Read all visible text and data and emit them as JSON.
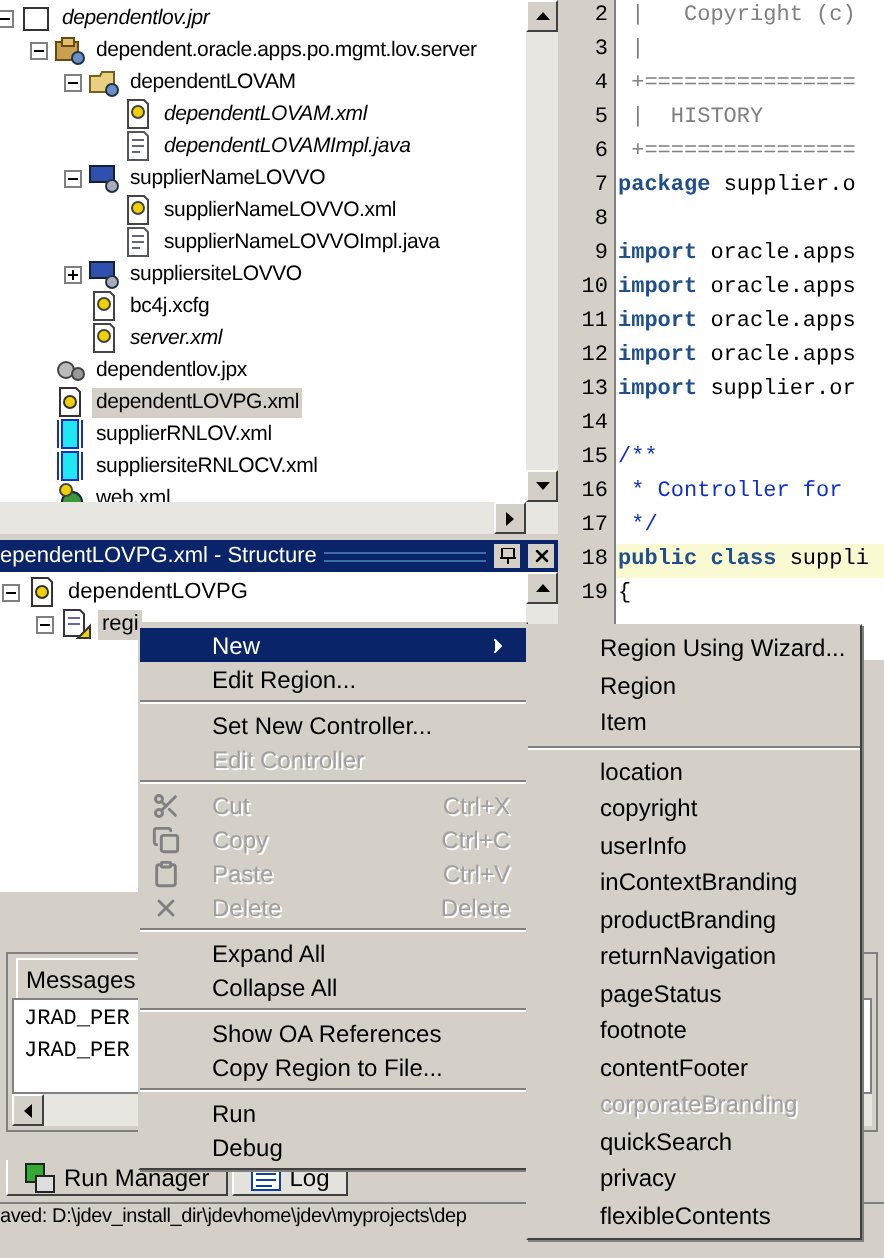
{
  "navigator": {
    "tree": [
      {
        "label": "dependentlov.jpr",
        "kind": "project",
        "italic": true,
        "expanded": true,
        "selected": false,
        "children": [
          {
            "label": "dependent.oracle.apps.po.mgmt.lov.server",
            "kind": "package",
            "expanded": true,
            "selected": false,
            "children": [
              {
                "label": "dependentLOVAM",
                "kind": "module",
                "expanded": true,
                "selected": false,
                "children": [
                  {
                    "label": "dependentLOVAM.xml",
                    "kind": "xml",
                    "italic": true,
                    "selected": false
                  },
                  {
                    "label": "dependentLOVAMImpl.java",
                    "kind": "java",
                    "italic": true,
                    "selected": false
                  }
                ]
              },
              {
                "label": "supplierNameLOVVO",
                "kind": "view",
                "expanded": true,
                "selected": false,
                "children": [
                  {
                    "label": "supplierNameLOVVO.xml",
                    "kind": "xml",
                    "selected": false
                  },
                  {
                    "label": "supplierNameLOVVOImpl.java",
                    "kind": "java",
                    "selected": false
                  }
                ]
              },
              {
                "label": "suppliersiteLOVVO",
                "kind": "view",
                "expanded": false,
                "selected": false
              },
              {
                "label": "bc4j.xcfg",
                "kind": "xml",
                "selected": false
              },
              {
                "label": "server.xml",
                "kind": "xml",
                "italic": true,
                "selected": false
              }
            ]
          },
          {
            "label": "dependentlov.jpx",
            "kind": "gears",
            "selected": false
          },
          {
            "label": "dependentLOVPG.xml",
            "kind": "page",
            "selected": true
          },
          {
            "label": "supplierRNLOV.xml",
            "kind": "region",
            "selected": false
          },
          {
            "label": "suppliersiteRNLOCV.xml",
            "kind": "region",
            "selected": false
          },
          {
            "label": "web.xml",
            "kind": "web",
            "selected": false
          }
        ]
      }
    ]
  },
  "structure": {
    "title": "ependentLOVPG.xml - Structure",
    "tree": [
      {
        "label": "dependentLOVPG",
        "kind": "page",
        "expanded": true,
        "selected": false,
        "children": [
          {
            "label": "regi",
            "kind": "regionedit",
            "expanded": true,
            "selected": true
          }
        ]
      }
    ]
  },
  "editor": {
    "lines": [
      {
        "number": "2",
        "segments": [
          {
            "kind": "comment",
            "text": " |   Copyright (c)"
          }
        ]
      },
      {
        "number": "3",
        "segments": [
          {
            "kind": "comment",
            "text": " |"
          }
        ]
      },
      {
        "number": "4",
        "segments": [
          {
            "kind": "comment",
            "text": " +================"
          }
        ]
      },
      {
        "number": "5",
        "segments": [
          {
            "kind": "comment",
            "text": " |  HISTORY"
          }
        ]
      },
      {
        "number": "6",
        "segments": [
          {
            "kind": "comment",
            "text": " +================"
          }
        ]
      },
      {
        "number": "7",
        "segments": [
          {
            "kind": "keyword",
            "text": "package"
          },
          {
            "kind": "plain",
            "text": " supplier.o"
          }
        ]
      },
      {
        "number": "8"
      },
      {
        "number": "9",
        "segments": [
          {
            "kind": "keyword",
            "text": "import"
          },
          {
            "kind": "plain",
            "text": " oracle.apps"
          }
        ]
      },
      {
        "number": "10",
        "segments": [
          {
            "kind": "keyword",
            "text": "import"
          },
          {
            "kind": "plain",
            "text": " oracle.apps"
          }
        ]
      },
      {
        "number": "11",
        "segments": [
          {
            "kind": "keyword",
            "text": "import"
          },
          {
            "kind": "plain",
            "text": " oracle.apps"
          }
        ]
      },
      {
        "number": "12",
        "segments": [
          {
            "kind": "keyword",
            "text": "import"
          },
          {
            "kind": "plain",
            "text": " oracle.apps"
          }
        ]
      },
      {
        "number": "13",
        "segments": [
          {
            "kind": "keyword",
            "text": "import"
          },
          {
            "kind": "plain",
            "text": " supplier.or"
          }
        ]
      },
      {
        "number": "14"
      },
      {
        "number": "15",
        "segments": [
          {
            "kind": "doc",
            "text": "/**"
          }
        ]
      },
      {
        "number": "16",
        "segments": [
          {
            "kind": "doc",
            "text": " * Controller for"
          }
        ]
      },
      {
        "number": "17",
        "segments": [
          {
            "kind": "doc",
            "text": " */"
          }
        ]
      },
      {
        "number": "18",
        "highlighted": true,
        "segments": [
          {
            "kind": "keyword",
            "text": "public class"
          },
          {
            "kind": "plain",
            "text": " suppli"
          }
        ]
      },
      {
        "number": "19",
        "segments": [
          {
            "kind": "plain",
            "text": "{"
          }
        ]
      }
    ]
  },
  "messages": {
    "tab": "Messages",
    "rows": [
      "JRAD_PER",
      "JRAD_PER"
    ]
  },
  "bottom_tabs": [
    {
      "label": "Run Manager",
      "kind": "run",
      "selected": false
    },
    {
      "label": "Log",
      "kind": "log",
      "selected": true
    }
  ],
  "status_bar": "aved: D:\\jdev_install_dir\\jdevhome\\jdev\\myprojects\\dep",
  "context_menu": [
    {
      "kind": "submenu",
      "label": "New",
      "selected": true,
      "disabled": false
    },
    {
      "kind": "command",
      "label": "Edit Region...",
      "selected": false,
      "disabled": false
    },
    {
      "kind": "separator"
    },
    {
      "kind": "command",
      "label": "Set New Controller...",
      "selected": false,
      "disabled": false
    },
    {
      "kind": "command",
      "label": "Edit Controller",
      "selected": false,
      "disabled": true
    },
    {
      "kind": "separator"
    },
    {
      "kind": "cut",
      "label": "Cut",
      "shortcut": "Ctrl+X",
      "selected": false,
      "disabled": true
    },
    {
      "kind": "copy",
      "label": "Copy",
      "shortcut": "Ctrl+C",
      "selected": false,
      "disabled": true
    },
    {
      "kind": "paste",
      "label": "Paste",
      "shortcut": "Ctrl+V",
      "selected": false,
      "disabled": true
    },
    {
      "kind": "delete",
      "label": "Delete",
      "shortcut": "Delete",
      "selected": false,
      "disabled": true
    },
    {
      "kind": "separator"
    },
    {
      "kind": "command",
      "label": "Expand All",
      "selected": false,
      "disabled": false
    },
    {
      "kind": "command",
      "label": "Collapse All",
      "selected": false,
      "disabled": false
    },
    {
      "kind": "separator"
    },
    {
      "kind": "command",
      "label": "Show OA References",
      "selected": false,
      "disabled": false
    },
    {
      "kind": "command",
      "label": "Copy Region to File...",
      "selected": false,
      "disabled": false
    },
    {
      "kind": "separator"
    },
    {
      "kind": "command",
      "label": "Run",
      "selected": false,
      "disabled": false
    },
    {
      "kind": "command",
      "label": "Debug",
      "selected": false,
      "disabled": false
    }
  ],
  "submenu": [
    {
      "kind": "command",
      "label": "Region Using Wizard...",
      "selected": false,
      "disabled": false
    },
    {
      "kind": "command",
      "label": "Region",
      "selected": false,
      "disabled": false
    },
    {
      "kind": "command",
      "label": "Item",
      "selected": false,
      "disabled": false
    },
    {
      "kind": "separator"
    },
    {
      "kind": "command",
      "label": "location",
      "selected": false,
      "disabled": false
    },
    {
      "kind": "command",
      "label": "copyright",
      "selected": false,
      "disabled": false
    },
    {
      "kind": "command",
      "label": "userInfo",
      "selected": false,
      "disabled": false
    },
    {
      "kind": "command",
      "label": "inContextBranding",
      "selected": false,
      "disabled": false
    },
    {
      "kind": "command",
      "label": "productBranding",
      "selected": false,
      "disabled": false
    },
    {
      "kind": "command",
      "label": "returnNavigation",
      "selected": false,
      "disabled": false
    },
    {
      "kind": "command",
      "label": "pageStatus",
      "selected": false,
      "disabled": false
    },
    {
      "kind": "command",
      "label": "footnote",
      "selected": false,
      "disabled": false
    },
    {
      "kind": "command",
      "label": "contentFooter",
      "selected": false,
      "disabled": false
    },
    {
      "kind": "command",
      "label": "corporateBranding",
      "selected": false,
      "disabled": true
    },
    {
      "kind": "command",
      "label": "quickSearch",
      "selected": false,
      "disabled": false
    },
    {
      "kind": "command",
      "label": "privacy",
      "selected": false,
      "disabled": false
    },
    {
      "kind": "command",
      "label": "flexibleContents",
      "selected": false,
      "disabled": false
    }
  ]
}
